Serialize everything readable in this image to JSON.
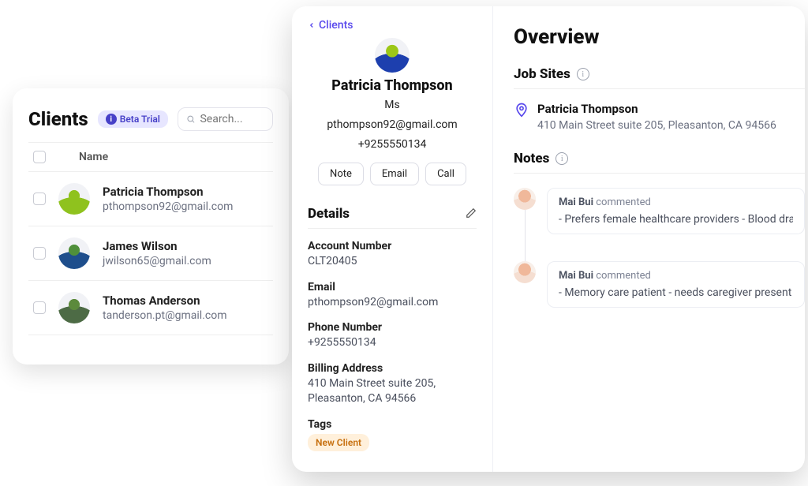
{
  "list": {
    "title": "Clients",
    "beta_label": "Beta Trial",
    "search_placeholder": "Search...",
    "name_header": "Name",
    "rows": [
      {
        "name": "Patricia Thompson",
        "email": "pthompson92@gmail.com",
        "head": "#8fc21e",
        "body": "#8fc21e"
      },
      {
        "name": "James Wilson",
        "email": "jwilson65@gmail.com",
        "head": "#4f8f3a",
        "body": "#1e4e8c"
      },
      {
        "name": "Thomas Anderson",
        "email": "tanderson.pt@gmail.com",
        "head": "#5c8a3c",
        "body": "#4d6b45"
      }
    ]
  },
  "detail": {
    "back_label": "Clients",
    "name": "Patricia Thompson",
    "honorific": "Ms",
    "email": "pthompson92@gmail.com",
    "phone": "+9255550134",
    "buttons": {
      "note": "Note",
      "email": "Email",
      "call": "Call"
    },
    "details_label": "Details",
    "fields": {
      "account_label": "Account Number",
      "account_value": "CLT20405",
      "email_label": "Email",
      "email_value": "pthompson92@gmail.com",
      "phone_label": "Phone Number",
      "phone_value": "+9255550134",
      "billing_label": "Billing Address",
      "billing_value": "410 Main Street suite 205, Pleasanton, CA 94566",
      "tags_label": "Tags",
      "tag_value": "New Client"
    }
  },
  "overview": {
    "title": "Overview",
    "jobsites_label": "Job Sites",
    "jobsite_name": "Patricia Thompson",
    "jobsite_address": "410 Main Street suite 205, Pleasanton, CA 94566",
    "notes_label": "Notes",
    "notes": [
      {
        "author": "Mai Bui",
        "verb": "commented",
        "body": "- Prefers female healthcare providers - Blood dra"
      },
      {
        "author": "Mai Bui",
        "verb": "commented",
        "body": "- Memory care patient - needs caregiver present"
      }
    ]
  }
}
